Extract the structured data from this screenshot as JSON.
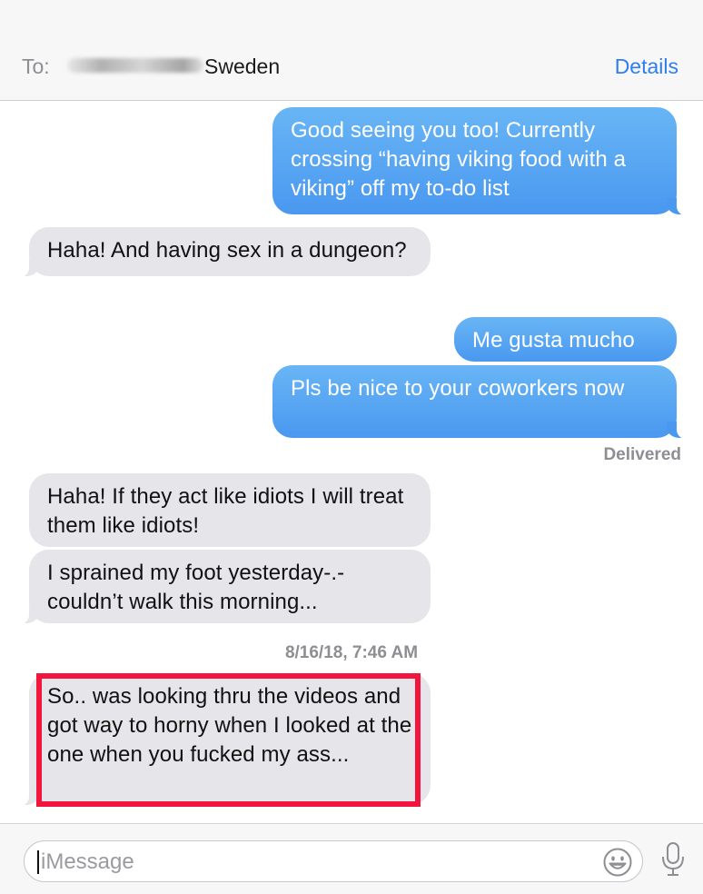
{
  "header": {
    "to_label": "To:",
    "recipient_suffix": "Sweden",
    "details_label": "Details"
  },
  "messages": [
    {
      "direction": "outgoing",
      "text": "Good seeing you too! Currently crossing “having viking food with a viking” off my to-do list"
    },
    {
      "direction": "incoming",
      "text": "Haha! And having sex in a dungeon?"
    },
    {
      "direction": "outgoing",
      "text": "Me gusta mucho"
    },
    {
      "direction": "outgoing",
      "text": "Pls be nice to your coworkers now"
    },
    {
      "direction": "incoming",
      "text": "Haha! If they act like idiots I will treat them like idiots!"
    },
    {
      "direction": "incoming",
      "text": "I sprained my foot yesterday-.- couldn’t walk this morning..."
    },
    {
      "direction": "incoming",
      "text": "So.. was looking thru the videos and got way to horny when I looked at the one when you fucked my ass..."
    }
  ],
  "delivery_status": "Delivered",
  "timestamp": "8/16/18, 7:46 AM",
  "composer": {
    "placeholder": "iMessage"
  },
  "icons": [
    "emoji-icon",
    "microphone-icon"
  ],
  "colors": {
    "outgoing_bubble": "#4a98f0",
    "incoming_bubble": "#e5e5ea",
    "link": "#2f7ef0",
    "highlight": "#f2163e"
  }
}
